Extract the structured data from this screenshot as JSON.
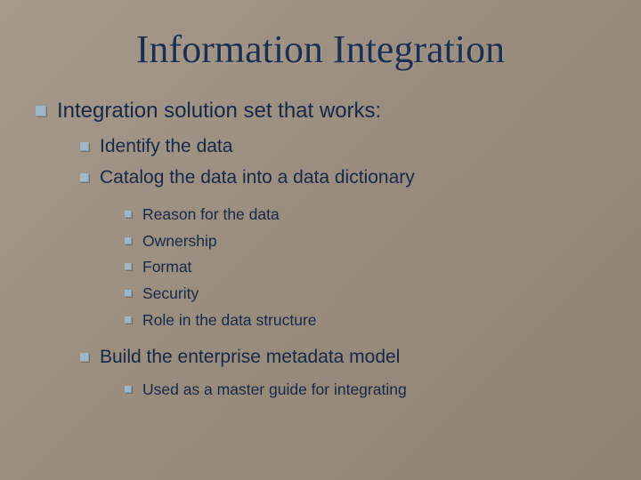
{
  "title": "Information Integration",
  "bullets": {
    "l1_1": "Integration solution set that works:",
    "l2_1": "Identify the data",
    "l2_2": "Catalog the data into a data dictionary",
    "l3_1": "Reason for the data",
    "l3_2": "Ownership",
    "l3_3": "Format",
    "l3_4": "Security",
    "l3_5": "Role in the data structure",
    "l2_3": "Build the enterprise metadata model",
    "l3_6": "Used as a master guide for integrating"
  },
  "colors": {
    "bullet": "#9fb8c9",
    "text": "#13284a"
  }
}
